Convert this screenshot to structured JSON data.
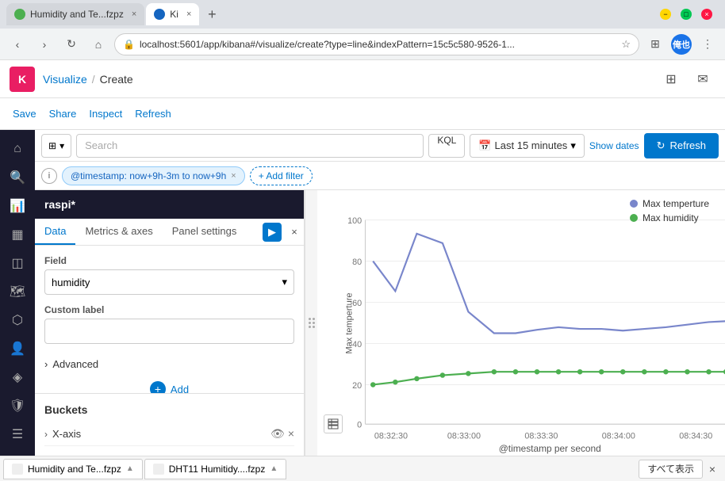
{
  "window": {
    "title": "Ki × +",
    "controls": {
      "min": "−",
      "max": "□",
      "close": "×"
    }
  },
  "tabs": [
    {
      "label": "Humidity and Te...fzpz",
      "active": false,
      "favicon_color": "#4caf50"
    },
    {
      "label": "Ki",
      "active": true,
      "favicon_color": "#1565c0"
    },
    {
      "label": "new_tab",
      "active": false,
      "is_new": true
    }
  ],
  "addressbar": {
    "url": "localhost:5601/app/kibana#/visualize/create?type=line&indexPattern=15c5c580-9526-1...",
    "profile_initials": "俺也"
  },
  "app": {
    "logo": "K",
    "breadcrumb_parent": "Visualize",
    "breadcrumb_current": "Create"
  },
  "toolbar": {
    "save_label": "Save",
    "share_label": "Share",
    "inspect_label": "Inspect",
    "refresh_label": "Refresh"
  },
  "querybar": {
    "search_placeholder": "Search",
    "kql_label": "KQL",
    "calendar_icon": "📅",
    "time_range": "Last 15 minutes",
    "show_dates_label": "Show dates",
    "refresh_btn_label": "Refresh",
    "refresh_icon": "↻"
  },
  "filterbar": {
    "filter_chip_text": "@timestamp: now+9h-3m to now+9h",
    "add_filter_label": "+ Add filter"
  },
  "left_panel": {
    "title": "raspi*",
    "tabs": [
      "Data",
      "Metrics & axes",
      "Panel settings"
    ],
    "active_tab": "Data",
    "field_label": "Field",
    "field_value": "humidity",
    "custom_label_label": "Custom label",
    "custom_label_placeholder": "",
    "advanced_label": "Advanced",
    "add_label": "Add",
    "buckets_title": "Buckets",
    "bucket_items": [
      {
        "label": "X-axis"
      }
    ]
  },
  "chart": {
    "y_axis_label": "Max temperture",
    "x_axis_label": "@timestamp per second",
    "y_max": 100,
    "y_min": 0,
    "y_ticks": [
      0,
      20,
      40,
      60,
      80,
      100
    ],
    "x_labels": [
      "08:32:30",
      "08:33:00",
      "08:33:30",
      "08:34:00",
      "08:34:30"
    ],
    "legend": [
      {
        "label": "Max temperture",
        "color": "#7986cb"
      },
      {
        "label": "Max humidity",
        "color": "#4caf50"
      }
    ],
    "series": {
      "temperature": {
        "color": "#7986cb",
        "points": [
          [
            0.02,
            0.78
          ],
          [
            0.08,
            0.62
          ],
          [
            0.14,
            0.9
          ],
          [
            0.22,
            0.85
          ],
          [
            0.3,
            0.52
          ],
          [
            0.38,
            0.42
          ],
          [
            0.45,
            0.42
          ],
          [
            0.52,
            0.44
          ],
          [
            0.58,
            0.45
          ],
          [
            0.64,
            0.45
          ],
          [
            0.7,
            0.44
          ],
          [
            0.76,
            0.44
          ],
          [
            0.82,
            0.44
          ],
          [
            0.88,
            0.45
          ],
          [
            0.94,
            0.46
          ],
          [
            0.98,
            0.47
          ]
        ]
      },
      "humidity": {
        "color": "#4caf50",
        "points": [
          [
            0.02,
            0.21
          ],
          [
            0.08,
            0.22
          ],
          [
            0.14,
            0.24
          ],
          [
            0.22,
            0.25
          ],
          [
            0.3,
            0.26
          ],
          [
            0.38,
            0.27
          ],
          [
            0.45,
            0.27
          ],
          [
            0.52,
            0.27
          ],
          [
            0.58,
            0.27
          ],
          [
            0.64,
            0.27
          ],
          [
            0.7,
            0.27
          ],
          [
            0.76,
            0.27
          ],
          [
            0.82,
            0.27
          ],
          [
            0.88,
            0.27
          ],
          [
            0.94,
            0.27
          ],
          [
            0.98,
            0.27
          ]
        ]
      }
    }
  },
  "bottom_tabs": [
    {
      "label": "Humidity and Te...fzpz",
      "active": true
    },
    {
      "label": "DHT11 Humitidy....fzpz",
      "active": false
    }
  ],
  "bottom_bar": {
    "show_all_label": "すべて表示",
    "close_label": "×"
  }
}
